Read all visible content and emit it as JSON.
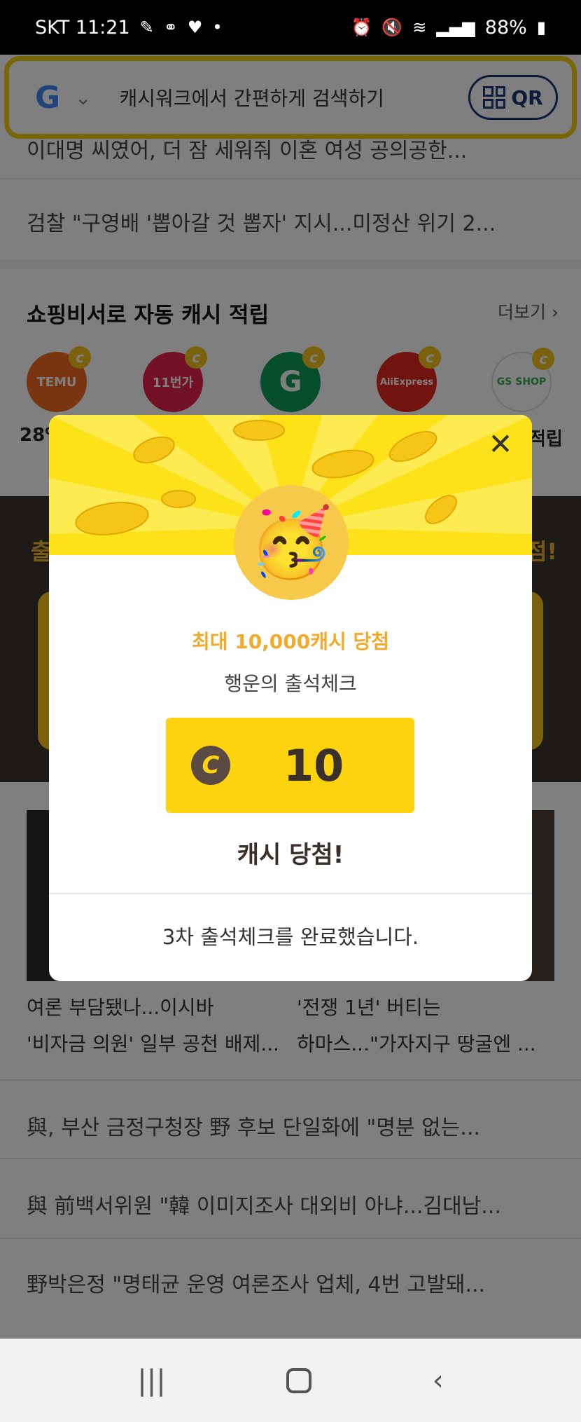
{
  "status_bar": {
    "carrier_time": "SKT 11:21",
    "battery": "88%",
    "icons": [
      "pen-icon",
      "voicemail-icon",
      "heart-icon",
      "dot-icon",
      "alarm-icon",
      "mute-icon",
      "wifi-icon",
      "signal-icon",
      "battery-icon"
    ]
  },
  "search": {
    "logo": "G",
    "placeholder": "캐시워크에서 간편하게 검색하기",
    "qr_label": "QR"
  },
  "news_top": [
    "이대명 씨였어, 더 잠 세워줘 이혼 여성 공의공한...",
    "검찰 \"구영배 '뽑아갈 것 뽑자' 지시...미정산 위기 2..."
  ],
  "shopping": {
    "title": "쇼핑비서로 자동 캐시 적립",
    "more": "더보기",
    "stores": [
      {
        "name": "TEMU",
        "color": "#f36b21"
      },
      {
        "name": "11번가",
        "color": "#e6244f"
      },
      {
        "name": "G",
        "color": "#0f9d58"
      },
      {
        "name": "AliExpress",
        "color": "#e5281c"
      },
      {
        "name": "GS SHOP",
        "color": "#ffffff"
      }
    ],
    "caption_left": "28%",
    "caption_right": "적립"
  },
  "banner": {
    "left_char": "출",
    "right_char": "점!"
  },
  "grid_news": [
    {
      "line1": "여론 부담됐나...이시바",
      "line2": "'비자금 의원' 일부 공천 배제..."
    },
    {
      "line1": "'전쟁 1년' 버티는",
      "line2": "하마스...\"가자지구 땅굴엔 ..."
    }
  ],
  "news_bottom": [
    "與, 부산 금정구청장 野 후보 단일화에 \"명분 없는...",
    "與 前백서위원 \"韓 이미지조사 대외비 아냐...김대남...",
    "野박은정 \"명태균 운영 여론조사 업체, 4번 고발돼..."
  ],
  "modal": {
    "close_icon": "close-icon",
    "headline": "최대 10,000캐시 당첨",
    "subtitle": "행운의 출석체크",
    "coin_symbol": "C",
    "amount": "10",
    "result": "캐시 당첨!",
    "footer": "3차 출석체크를 완료했습니다.",
    "accent_color": "#fde21a",
    "amount_box_color": "#fdd30f"
  },
  "nav": {
    "recent": "recent-apps-icon",
    "home": "home-icon",
    "back": "back-icon"
  }
}
